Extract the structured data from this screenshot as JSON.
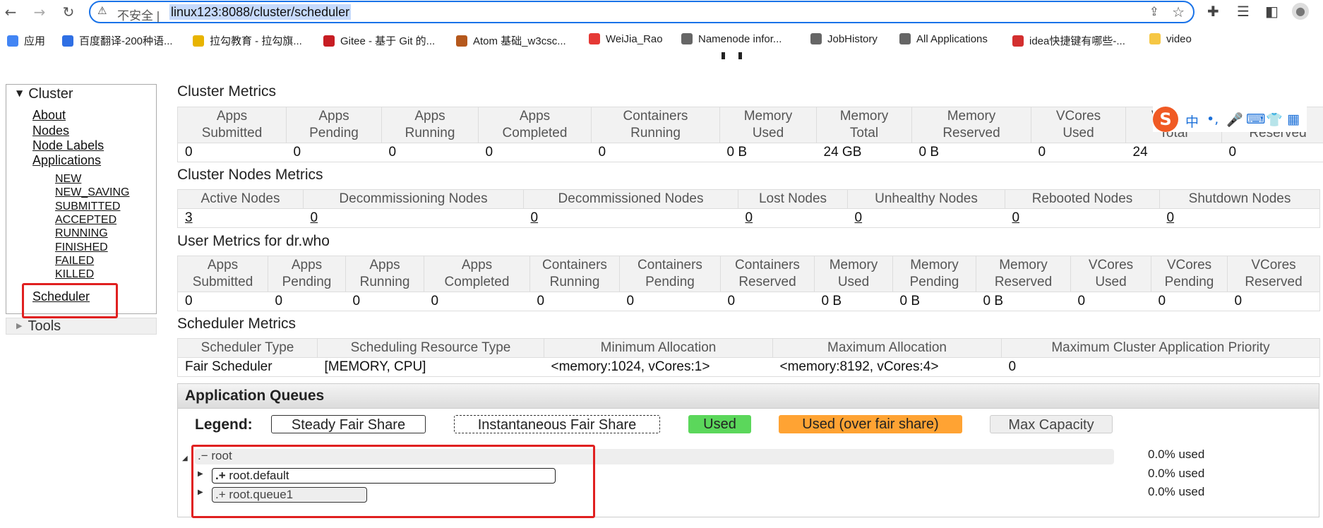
{
  "browser": {
    "back_icon": "←",
    "forward_icon": "→",
    "reload_icon": "↻",
    "insecure_label": "不安全",
    "url": "linux123:8088/cluster/scheduler",
    "bookmarks": [
      {
        "label": "应用",
        "color": "#4285f4"
      },
      {
        "label": "百度翻译-200种语...",
        "color": "#2f6fe4"
      },
      {
        "label": "拉勾教育 - 拉勾旗...",
        "color": "#e8b400"
      },
      {
        "label": "Gitee - 基于 Git 的...",
        "color": "#c71d23"
      },
      {
        "label": "Atom 基础_w3csc...",
        "color": "#b5581c"
      },
      {
        "label": "WeiJia_Rao",
        "color": "#e53935"
      },
      {
        "label": "Namenode infor...",
        "color": "#666666"
      },
      {
        "label": "JobHistory",
        "color": "#666666"
      },
      {
        "label": "All Applications",
        "color": "#666666"
      },
      {
        "label": "idea快捷键有哪些-...",
        "color": "#d32f2f"
      },
      {
        "label": "video",
        "color": "#f6c744"
      }
    ]
  },
  "sidebar": {
    "cluster_label": "Cluster",
    "links": [
      "About",
      "Nodes",
      "Node Labels",
      "Applications"
    ],
    "app_states": [
      "NEW",
      "NEW_SAVING",
      "SUBMITTED",
      "ACCEPTED",
      "RUNNING",
      "FINISHED",
      "FAILED",
      "KILLED"
    ],
    "scheduler_label": "Scheduler",
    "tools_label": "Tools"
  },
  "cluster_metrics": {
    "title": "Cluster Metrics",
    "headers": [
      [
        "Apps",
        "Submitted"
      ],
      [
        "Apps",
        "Pending"
      ],
      [
        "Apps",
        "Running"
      ],
      [
        "Apps",
        "Completed"
      ],
      [
        "Containers",
        "Running"
      ],
      [
        "Memory",
        "Used"
      ],
      [
        "Memory",
        "Total"
      ],
      [
        "Memory",
        "Reserved"
      ],
      [
        "VCores",
        "Used"
      ],
      [
        "VCores",
        "Total"
      ],
      [
        "VCores",
        "Reserved"
      ]
    ],
    "values": [
      "0",
      "0",
      "0",
      "0",
      "0",
      "0 B",
      "24 GB",
      "0 B",
      "0",
      "24",
      "0"
    ]
  },
  "nodes_metrics": {
    "title": "Cluster Nodes Metrics",
    "headers": [
      "Active Nodes",
      "Decommissioning Nodes",
      "Decommissioned Nodes",
      "Lost Nodes",
      "Unhealthy Nodes",
      "Rebooted Nodes",
      "Shutdown Nodes"
    ],
    "values": [
      "3",
      "0",
      "0",
      "0",
      "0",
      "0",
      "0"
    ]
  },
  "user_metrics": {
    "title": "User Metrics for dr.who",
    "headers": [
      [
        "Apps",
        "Submitted"
      ],
      [
        "Apps",
        "Pending"
      ],
      [
        "Apps",
        "Running"
      ],
      [
        "Apps",
        "Completed"
      ],
      [
        "Containers",
        "Running"
      ],
      [
        "Containers",
        "Pending"
      ],
      [
        "Containers",
        "Reserved"
      ],
      [
        "Memory",
        "Used"
      ],
      [
        "Memory",
        "Pending"
      ],
      [
        "Memory",
        "Reserved"
      ],
      [
        "VCores",
        "Used"
      ],
      [
        "VCores",
        "Pending"
      ],
      [
        "VCores",
        "Reserved"
      ]
    ],
    "values": [
      "0",
      "0",
      "0",
      "0",
      "0",
      "0",
      "0",
      "0 B",
      "0 B",
      "0 B",
      "0",
      "0",
      "0"
    ]
  },
  "scheduler_metrics": {
    "title": "Scheduler Metrics",
    "headers": [
      "Scheduler Type",
      "Scheduling Resource Type",
      "Minimum Allocation",
      "Maximum Allocation",
      "Maximum Cluster Application Priority"
    ],
    "values": [
      "Fair Scheduler",
      "[MEMORY, CPU]",
      "<memory:1024, vCores:1>",
      "<memory:8192, vCores:4>",
      "0"
    ]
  },
  "queues": {
    "title": "Application Queues",
    "legend_label": "Legend:",
    "legend": {
      "steady": "Steady Fair Share",
      "instant": "Instantaneous Fair Share",
      "used": "Used",
      "over": "Used (over fair share)",
      "max": "Max Capacity"
    },
    "colors": {
      "used": "#5bd75b",
      "over": "#ffa333",
      "max": "#eeeeee"
    },
    "rows": [
      {
        "name": "root",
        "toggle": ".−",
        "used": "0.0% used",
        "used_fraction": 0.0
      },
      {
        "name": "root.default",
        "toggle": ".+",
        "used": "0.0% used",
        "used_fraction": 0.0
      },
      {
        "name": "root.queue1",
        "toggle": ".+",
        "used": "0.0% used",
        "used_fraction": 0.0
      }
    ]
  },
  "ime": {
    "logo": "S",
    "items": [
      "中",
      "•,",
      "🎤",
      "⌨",
      "👕",
      "▦"
    ]
  }
}
